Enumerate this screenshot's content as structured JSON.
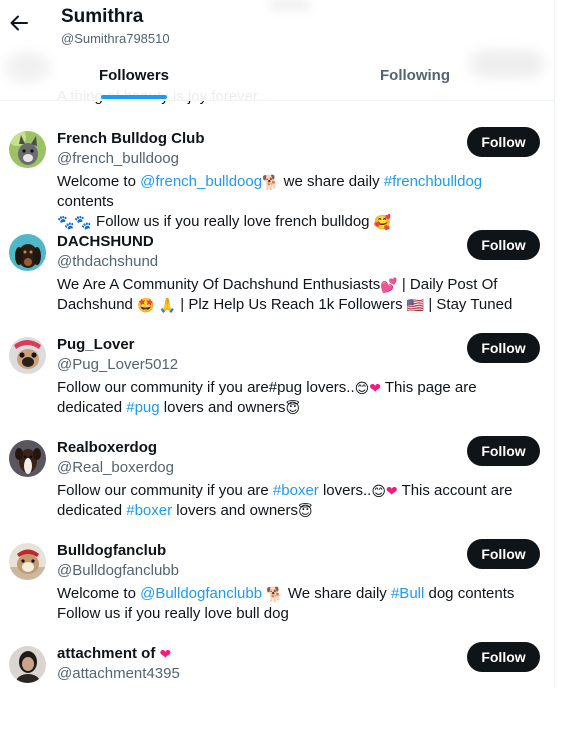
{
  "profile": {
    "name": "Sumithra",
    "handle": "@Sumithra798510"
  },
  "tabs": [
    {
      "label": "Followers",
      "active": true
    },
    {
      "label": "Following",
      "active": false
    }
  ],
  "clipped_text": "A thing of beauty is joy forever...",
  "users": [
    {
      "name": "French Bulldog Club",
      "handle": "@french_bulldoog",
      "follow_label": "Follow",
      "bio": {
        "t1": "Welcome to ",
        "mention": "@french_bulldoog",
        "t2": " we share daily ",
        "hashtag": "#frenchbulldog",
        "t3": " contents",
        "t4": " Follow us if you really love french bulldog "
      }
    },
    {
      "name": "DACHSHUND",
      "handle": "@thdachshund",
      "follow_label": "Follow",
      "bio": {
        "t1": "We Are A Community Of Dachshund Enthusiasts",
        "t2": " | Daily Post Of",
        "t3": "Dachshund ",
        "t4": " | Plz Help Us Reach 1k Followers ",
        "t5": " | Stay Tuned"
      }
    },
    {
      "name": "Pug_Lover",
      "handle": "@Pug_Lover5012",
      "follow_label": "Follow",
      "bio": {
        "t1": "Follow our community if you are#pug lovers..",
        "t2": " This page are",
        "t3": "dedicated ",
        "hashtag": "#pug",
        "t4": " lovers and owners"
      }
    },
    {
      "name": "Realboxerdog",
      "handle": "@Real_boxerdog",
      "follow_label": "Follow",
      "bio": {
        "t1": "Follow our community if you are ",
        "hashtag": "#boxer",
        "t2": " lovers..",
        "t3": " This account are",
        "t4": "dedicated ",
        "hashtag2": "#boxer",
        "t5": " lovers and owners"
      }
    },
    {
      "name": "Bulldogfanclub",
      "handle": "@Bulldogfanclubb",
      "follow_label": "Follow",
      "bio": {
        "t1": "Welcome to ",
        "mention": "@Bulldogfanclubb",
        "t2": " We share daily ",
        "hashtag": "#Bull",
        "t3": " dog contents",
        "t4": "Follow us if you really love bull dog"
      }
    },
    {
      "name": "attachment of ",
      "handle": "@attachment4395",
      "follow_label": "Follow"
    }
  ],
  "colors": {
    "accent": "#1d9bf0",
    "button": "#0f1419",
    "secondary_text": "#536471"
  },
  "icons": {
    "back": "arrow-left-icon"
  }
}
